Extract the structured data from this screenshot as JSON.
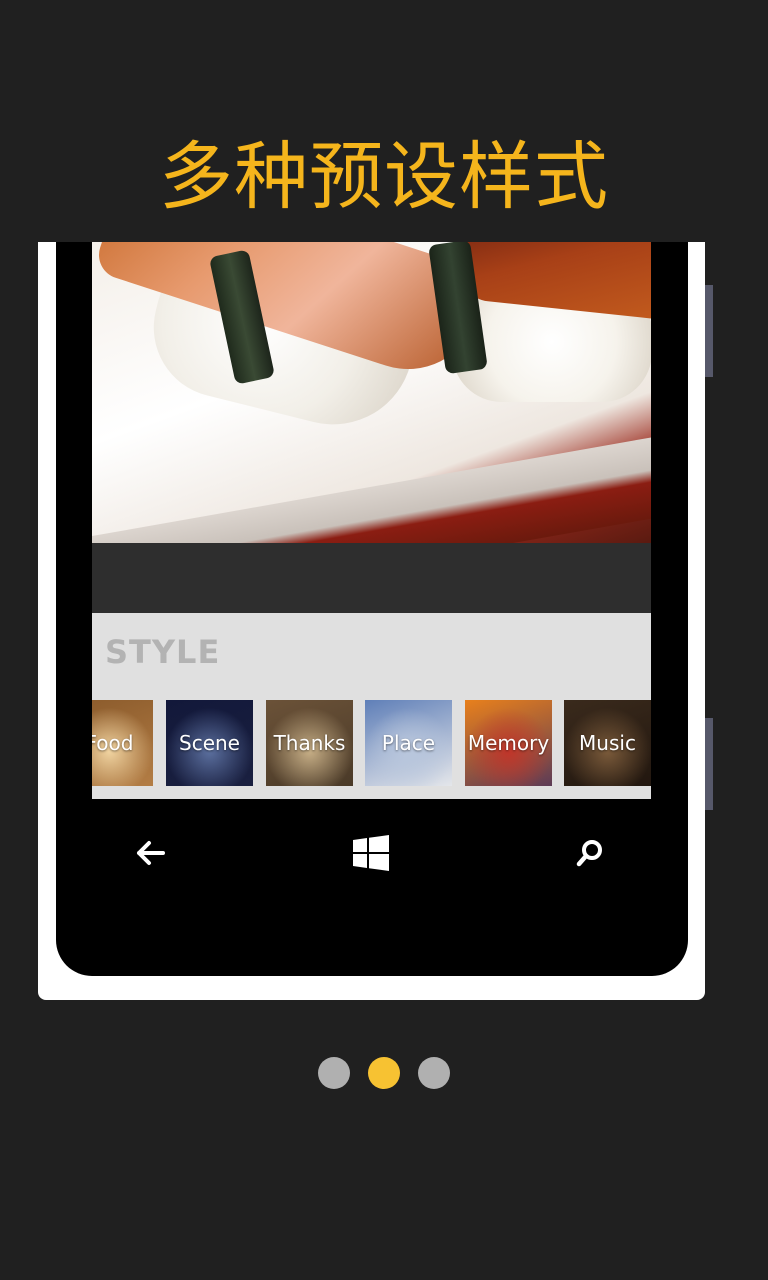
{
  "headline": "多种预设样式",
  "style_panel": {
    "title": "STYLE",
    "tiles": [
      {
        "label": "Food",
        "colors": [
          "#8a5a2b",
          "#f0d3a0",
          "#b37d45"
        ]
      },
      {
        "label": "Scene",
        "colors": [
          "#12183a",
          "#5b6f9e",
          "#1a2040"
        ]
      },
      {
        "label": "Thanks",
        "colors": [
          "#6b5238",
          "#c6ae86",
          "#4a3a28"
        ]
      },
      {
        "label": "Place",
        "colors": [
          "#5f7fb8",
          "#b9c7dd",
          "#e4e6ea"
        ]
      },
      {
        "label": "Memory",
        "colors": [
          "#e8801c",
          "#c0352a",
          "#5d3b56"
        ]
      },
      {
        "label": "Music",
        "colors": [
          "#3a2a1c",
          "#7a5a3a",
          "#22170f"
        ]
      }
    ]
  },
  "nav": {
    "back": "back-arrow-icon",
    "home": "windows-logo-icon",
    "search": "search-icon"
  },
  "pagination": {
    "count": 3,
    "active_index": 1,
    "active_color": "#f7c232",
    "inactive_color": "#b0b0b0"
  },
  "colors": {
    "background": "#202020",
    "headline": "#f5b51c"
  }
}
